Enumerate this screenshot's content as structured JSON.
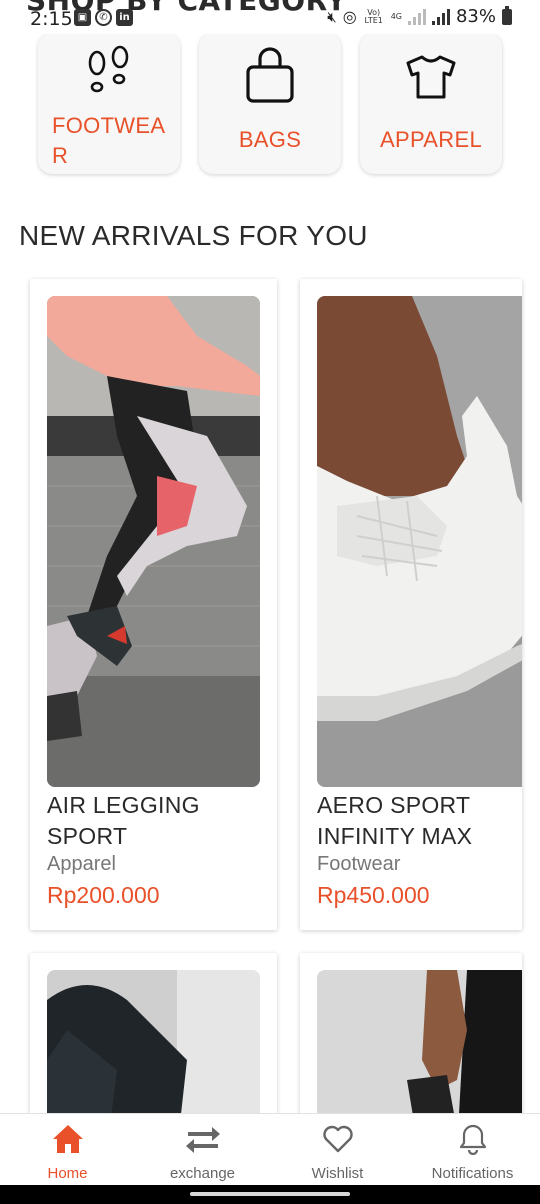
{
  "status_bar": {
    "partial_title": "SHOP BY CATEGORY",
    "time": "2:15",
    "network_label": "Vo) LTE1",
    "network_type": "4G",
    "battery_percent": "83%"
  },
  "categories": [
    {
      "label": "FOOTWEAR",
      "icon": "footprints-icon"
    },
    {
      "label": "BAGS",
      "icon": "bag-icon"
    },
    {
      "label": "APPAREL",
      "icon": "tshirt-icon"
    }
  ],
  "section_title": "NEW ARRIVALS FOR YOU",
  "products": [
    {
      "name": "AIR LEGGING SPORT",
      "category": "Apparel",
      "price": "Rp200.000"
    },
    {
      "name": "AERO SPORT INFINITY MAX",
      "category": "Footwear",
      "price": "Rp450.000"
    }
  ],
  "bottom_nav": [
    {
      "label": "Home",
      "icon": "home-icon",
      "active": true
    },
    {
      "label": "exchange",
      "icon": "exchange-icon",
      "active": false
    },
    {
      "label": "Wishlist",
      "icon": "heart-icon",
      "active": false
    },
    {
      "label": "Notifications",
      "icon": "bell-icon",
      "active": false
    }
  ],
  "colors": {
    "accent": "#e8512a",
    "text": "#2a2a2a",
    "muted": "#777777"
  }
}
